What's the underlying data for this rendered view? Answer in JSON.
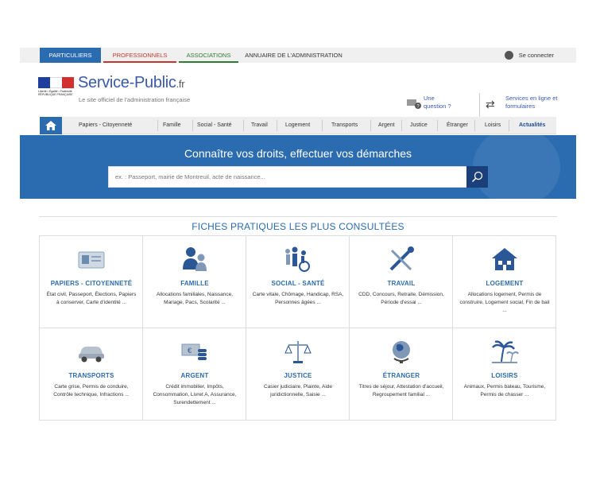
{
  "topbar": {
    "tabs": [
      "PARTICULIERS",
      "PROFESSIONNELS",
      "ASSOCIATIONS",
      "ANNUAIRE DE L'ADMINISTRATION"
    ],
    "login_label": "Se connecter"
  },
  "header": {
    "brand": "Service-Public",
    "brand_tld": ".fr",
    "tagline": "Le site officiel de l'administration française",
    "logo_text": "Liberté • Égalité • Fraternité RÉPUBLIQUE FRANÇAISE",
    "help_line1": "Une",
    "help_line2": "question ?",
    "services_label": "Services en ligne et formulaires"
  },
  "nav": {
    "items": [
      "Papiers - Citoyenneté",
      "Famille",
      "Social - Santé",
      "Travail",
      "Logement",
      "Transports",
      "Argent",
      "Justice",
      "Étranger",
      "Loisirs",
      "Actualités"
    ]
  },
  "hero": {
    "title": "Connaître vos droits, effectuer vos démarches",
    "search_placeholder": "ex. : Passeport, mairie de Montreuil, acte de naissance..."
  },
  "section": {
    "title": "FICHES PRATIQUES LES PLUS CONSULTÉES"
  },
  "cards": [
    {
      "title": "PAPIERS - CITOYENNETÉ",
      "desc": "État civil, Passeport, Élections, Papiers à conserver, Carte d'identité ...",
      "icon": "id-card-icon"
    },
    {
      "title": "FAMILLE",
      "desc": "Allocations familiales, Naissance, Mariage, Pacs, Scolarité ...",
      "icon": "family-icon"
    },
    {
      "title": "SOCIAL - SANTÉ",
      "desc": "Carte vitale, Chômage, Handicap, RSA, Personnes âgées ...",
      "icon": "people-wheelchair-icon"
    },
    {
      "title": "TRAVAIL",
      "desc": "CDD, Concours, Retraite, Démission, Période d'essai ...",
      "icon": "tools-icon"
    },
    {
      "title": "LOGEMENT",
      "desc": "Allocations logement, Permis de construire, Logement social, Fin de bail ...",
      "icon": "house-icon"
    },
    {
      "title": "TRANSPORTS",
      "desc": "Carte grise, Permis de conduire, Contrôle technique, Infractions ...",
      "icon": "car-icon"
    },
    {
      "title": "ARGENT",
      "desc": "Crédit immobilier, Impôts, Consommation, Livret A, Assurance, Surendettement ...",
      "icon": "money-icon"
    },
    {
      "title": "JUSTICE",
      "desc": "Casier judiciaire, Plainte, Aide juridictionnelle, Saisie ...",
      "icon": "scales-icon"
    },
    {
      "title": "ÉTRANGER",
      "desc": "Titres de séjour, Attestation d'accueil, Regroupement familial ...",
      "icon": "globe-icon"
    },
    {
      "title": "LOISIRS",
      "desc": "Animaux, Permis bateau, Tourisme, Permis de chasser ...",
      "icon": "palm-tree-icon"
    }
  ],
  "colors": {
    "primary": "#2b6cb0",
    "professionnels": "#c0392b",
    "associations": "#2e7d32"
  }
}
